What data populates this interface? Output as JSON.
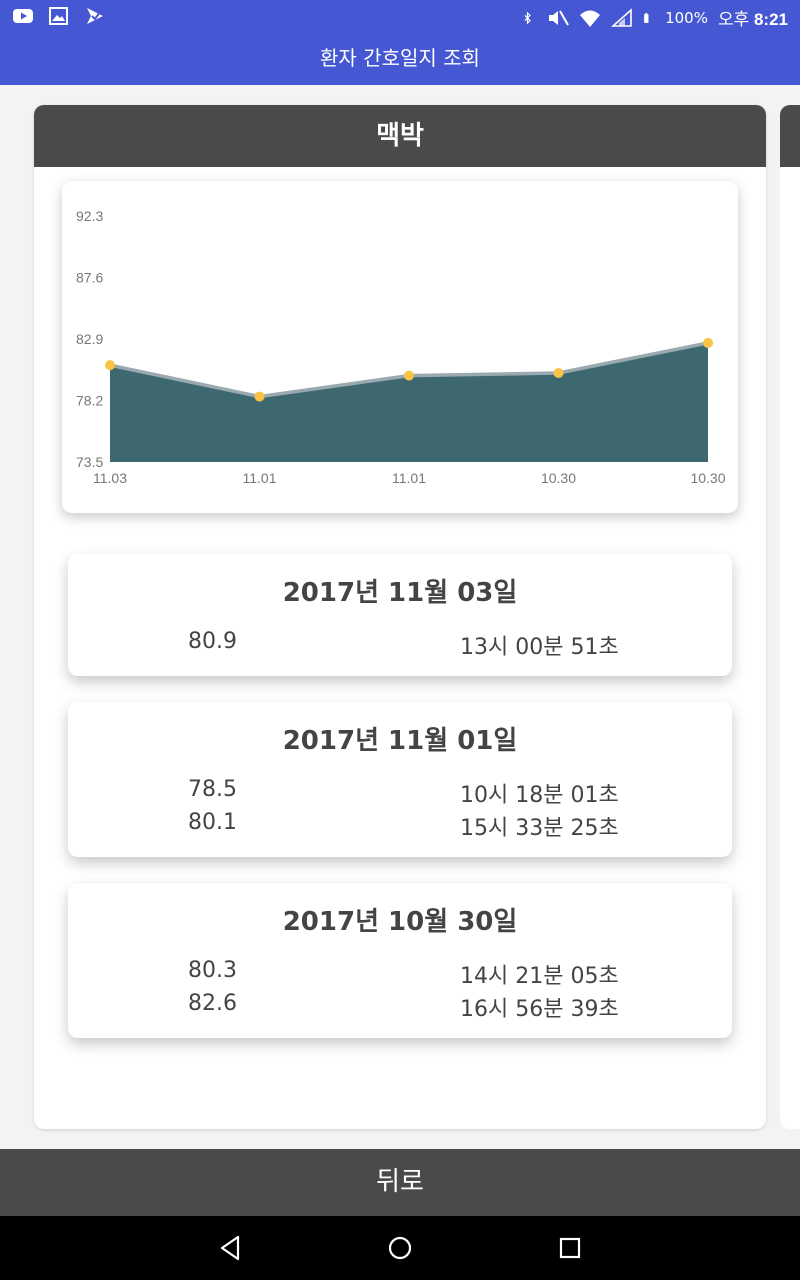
{
  "status_bar": {
    "battery_label": "100%",
    "clock_period": "오후",
    "clock_time": "8:21"
  },
  "app_bar": {
    "title": "환자 간호일지 조회"
  },
  "card": {
    "title": "맥박"
  },
  "chart_data": {
    "type": "area",
    "categories": [
      "11.03",
      "11.01",
      "11.01",
      "10.30",
      "10.30"
    ],
    "values": [
      80.9,
      78.5,
      80.1,
      80.3,
      82.6
    ],
    "yticks": [
      "92.3",
      "87.6",
      "82.9",
      "78.2",
      "73.5"
    ],
    "ylim": [
      73.5,
      92.3
    ],
    "colors": {
      "fill": "#3d6870",
      "line": "#9aa9b0",
      "point": "#f8c346"
    }
  },
  "days": [
    {
      "date": "2017년 11월 03일",
      "readings": [
        {
          "value": "80.9",
          "time": "13시 00분 51초"
        }
      ]
    },
    {
      "date": "2017년 11월 01일",
      "readings": [
        {
          "value": "78.5",
          "time": "10시 18분 01초"
        },
        {
          "value": "80.1",
          "time": "15시 33분 25초"
        }
      ]
    },
    {
      "date": "2017년 10월 30일",
      "readings": [
        {
          "value": "80.3",
          "time": "14시 21분 05초"
        },
        {
          "value": "82.6",
          "time": "16시 56분 39초"
        }
      ]
    }
  ],
  "back_button": {
    "label": "뒤로"
  },
  "icons": {
    "status_left": [
      "youtube-icon",
      "image-icon",
      "download-app-icon"
    ],
    "status_right": [
      "bluetooth-icon",
      "mute-icon",
      "wifi-icon",
      "signal-icon",
      "battery-icon"
    ],
    "nav": [
      "back-triangle-icon",
      "home-circle-icon",
      "recents-square-icon"
    ]
  }
}
